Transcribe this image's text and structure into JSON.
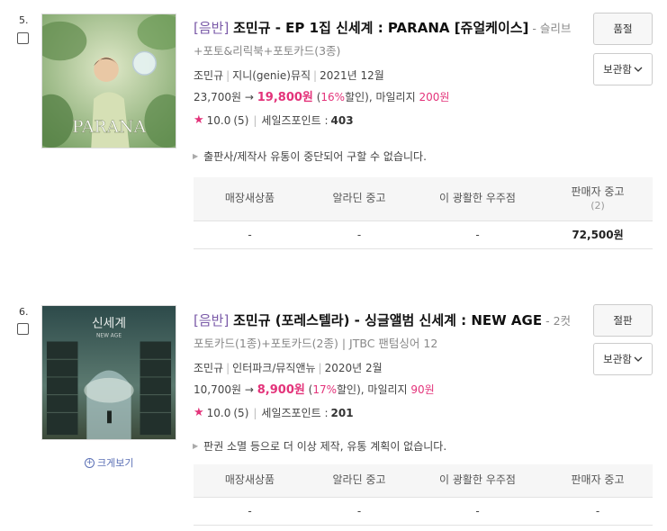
{
  "items": [
    {
      "number": "5.",
      "prefix": "[음반]",
      "title": "조민규 - EP 1집 신세계 : PARANA [쥬얼케이스]",
      "subtitle_a": " - 슬리브",
      "subtitle_b": "+포토&리릭북+포토카드(3종)",
      "artist": "조민규",
      "publisher": "지니(genie)뮤직",
      "date": "2021년 12월",
      "original_price": "23,700원",
      "arrow": "→",
      "sale_price": "19,800원",
      "discount_open": " (",
      "discount_pct": "16%",
      "discount_close": "할인), 마일리지 ",
      "mileage": "200원",
      "rating_score": "10.0",
      "rating_count": "(5)",
      "sales_point_label": "세일즈포인트 :",
      "sales_point": "403",
      "notice": "출판사/제작사 유통이 중단되어 구할 수 없습니다.",
      "btn_primary": "품절",
      "btn_secondary": "보관함",
      "seller_headers": [
        "매장새상품",
        "알라딘 중고",
        "이 광활한 우주점",
        "판매자 중고"
      ],
      "seller_header_count": "(2)",
      "seller_values": [
        "-",
        "-",
        "-",
        "72,500원"
      ]
    },
    {
      "number": "6.",
      "prefix": "[음반]",
      "title": "조민규 (포레스텔라) - 싱글앨범 신세계 : NEW AGE",
      "subtitle_a": " - 2컷",
      "subtitle_b": "포토카드(1종)+포토카드(2종) | JTBC 팬텀싱어 12",
      "artist": "조민규",
      "publisher": "인터파크/뮤직앤뉴",
      "date": "2020년 2월",
      "original_price": "10,700원",
      "arrow": "→",
      "sale_price": "8,900원",
      "discount_open": " (",
      "discount_pct": "17%",
      "discount_close": "할인), 마일리지 ",
      "mileage": "90원",
      "rating_score": "10.0",
      "rating_count": "(5)",
      "sales_point_label": "세일즈포인트 :",
      "sales_point": "201",
      "notice": "판권 소멸 등으로 더 이상 제작, 유통 계획이 없습니다.",
      "btn_primary": "절판",
      "btn_secondary": "보관함",
      "zoom_label": "크게보기",
      "seller_headers": [
        "매장새상품",
        "알라딘 중고",
        "이 광활한 우주점",
        "판매자 중고"
      ],
      "seller_values": [
        "-",
        "-",
        "-",
        "-"
      ]
    }
  ],
  "cover_texts": {
    "parana": "PARANA",
    "newage_title": "신세계",
    "newage_sub": "NEW AGE"
  },
  "colors": {
    "accent_pink": "#e3337a",
    "prefix_purple": "#7a5aa8",
    "zoom_blue": "#5a6fb5"
  }
}
